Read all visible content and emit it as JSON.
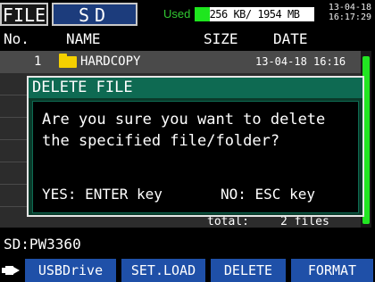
{
  "header": {
    "tabs": [
      {
        "label": "FILE"
      },
      {
        "label": "SD"
      }
    ],
    "used_label": "Used",
    "used_text": "256 KB/ 1954 MB",
    "used_fraction": 0.13,
    "date": "13-04-18",
    "time": "16:17:29"
  },
  "columns": {
    "no": "No.",
    "name": "NAME",
    "size": "SIZE",
    "date": "DATE"
  },
  "files": [
    {
      "no": "1",
      "name": "HARDCOPY",
      "date": "13-04-18 16:16",
      "type": "folder-icon"
    }
  ],
  "total": {
    "label": "total:",
    "value": "2 files"
  },
  "dialog": {
    "title": "DELETE FILE",
    "message": "Are you sure you want to delete\nthe specified file/folder?",
    "yes": "YES: ENTER key",
    "no": "NO: ESC key"
  },
  "status": {
    "path": "SD:PW3360"
  },
  "function_keys": [
    {
      "label": "USBDrive",
      "icon": "usb-plug-icon"
    },
    {
      "label": "SET.LOAD"
    },
    {
      "label": "DELETE"
    },
    {
      "label": "FORMAT"
    }
  ],
  "colors": {
    "accent_green": "#1ee61e",
    "dialog_title_bg": "#0e6a52",
    "key_blue": "#1f50a8",
    "folder_yellow": "#f5d000"
  }
}
